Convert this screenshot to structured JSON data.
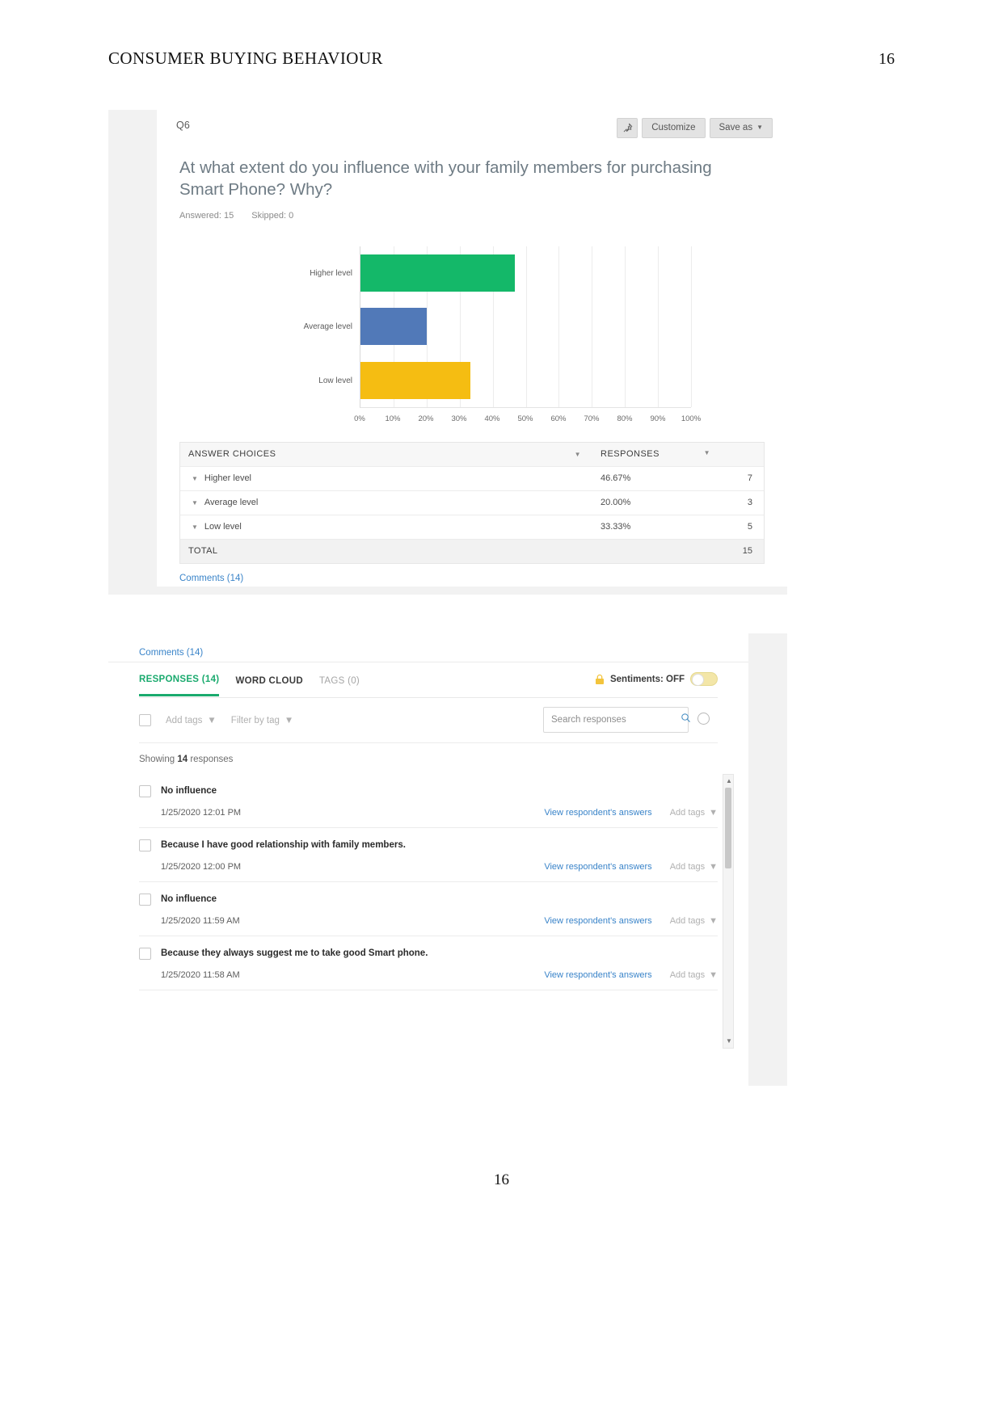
{
  "document": {
    "running_head": "CONSUMER BUYING BEHAVIOUR",
    "page_number_top": "16",
    "page_number_bottom": "16"
  },
  "survey_card": {
    "question_id": "Q6",
    "pin_icon": "pin-icon",
    "customize_label": "Customize",
    "save_as_label": "Save as",
    "save_as_caret": "▼",
    "question_title": "At what extent do you influence with your family members for purchasing Smart Phone? Why?",
    "answered_label": "Answered: 15",
    "skipped_label": "Skipped: 0",
    "comments_link": "Comments (14)"
  },
  "chart_data": {
    "type": "bar",
    "orientation": "horizontal",
    "title": "At what extent do you influence with your family members for purchasing Smart Phone? Why?",
    "categories": [
      "Higher level",
      "Average level",
      "Low level"
    ],
    "values": [
      46.67,
      20.0,
      33.33
    ],
    "counts": [
      7,
      3,
      5
    ],
    "colors": [
      "#14b869",
      "#5179b8",
      "#f5bd12"
    ],
    "xlabel": "",
    "ylabel": "",
    "xlim": [
      0,
      100
    ],
    "xticks": [
      "0%",
      "10%",
      "20%",
      "30%",
      "40%",
      "50%",
      "60%",
      "70%",
      "80%",
      "90%",
      "100%"
    ],
    "grid": true,
    "legend": "none"
  },
  "answer_table": {
    "columns": [
      "ANSWER CHOICES",
      "RESPONSES",
      ""
    ],
    "sort_caret": "▼",
    "row_caret": "▼",
    "rows": [
      {
        "choice": "Higher level",
        "percent": "46.67%",
        "count": "7"
      },
      {
        "choice": "Average level",
        "percent": "20.00%",
        "count": "3"
      },
      {
        "choice": "Low level",
        "percent": "33.33%",
        "count": "5"
      }
    ],
    "total_label": "TOTAL",
    "total_count": "15"
  },
  "comments_panel": {
    "comments_link": "Comments (14)",
    "tabs": [
      {
        "label": "RESPONSES (14)",
        "state": "active"
      },
      {
        "label": "WORD CLOUD",
        "state": "normal"
      },
      {
        "label": "TAGS (0)",
        "state": "muted"
      }
    ],
    "sentiments_label": "Sentiments: OFF",
    "lock_icon": "lock-icon",
    "toggle_state": "off",
    "add_tags_label": "Add tags",
    "filter_by_tag_label": "Filter by tag",
    "dropdown_caret": "▼",
    "search_placeholder": "Search responses",
    "search_value": "",
    "search_icon": "search-icon",
    "help_icon": "help-icon",
    "showing_prefix": "Showing",
    "showing_count": "14",
    "showing_suffix": "responses",
    "view_answers_label": "View respondent's answers",
    "row_add_tags_label": "Add tags",
    "responses": [
      {
        "text": "No influence",
        "date": "1/25/2020 12:01 PM"
      },
      {
        "text": "Because I have good relationship with family members.",
        "date": "1/25/2020 12:00 PM"
      },
      {
        "text": "No influence",
        "date": "1/25/2020 11:59 AM"
      },
      {
        "text": "Because they always suggest me to take good Smart phone.",
        "date": "1/25/2020 11:58 AM"
      }
    ],
    "scrollbar_up": "▲",
    "scrollbar_down": "▼"
  },
  "colors": {
    "green": "#14b869",
    "blue": "#5179b8",
    "yellow": "#f5bd12",
    "link": "#3a84c9",
    "tab_active": "#1aaa6e"
  }
}
